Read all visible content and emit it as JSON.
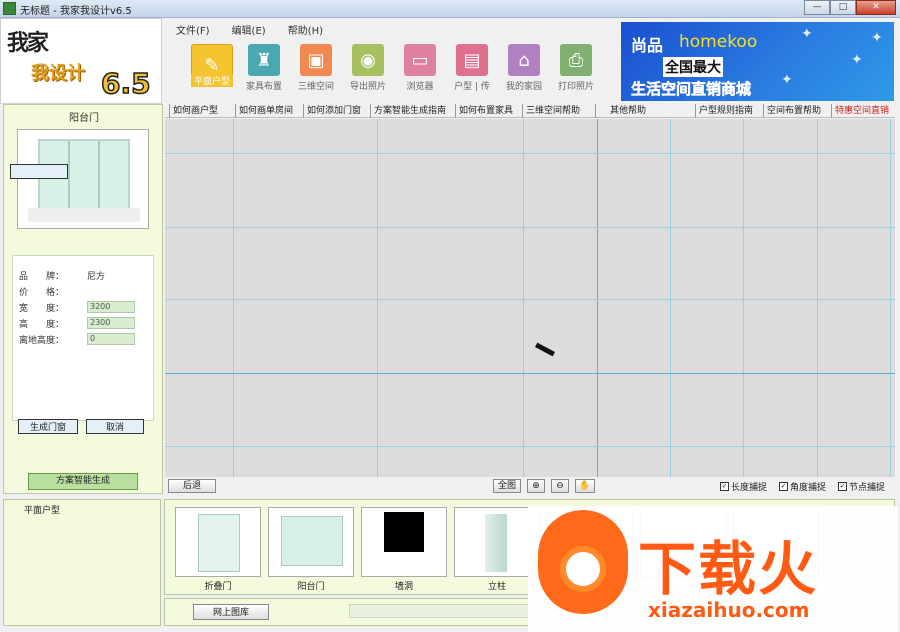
{
  "window": {
    "title": "无标题 - 我家我设计v6.5",
    "min": "—",
    "max": "□",
    "close": "✕"
  },
  "logo": {
    "line1": "我家",
    "line2": "我设计",
    "version": "6.5"
  },
  "menu": [
    "文件(F)",
    "编辑(E)",
    "帮助(H)"
  ],
  "toolbar": [
    {
      "label": "平面户型",
      "icon": "pencil-icon",
      "color": "#f4c430"
    },
    {
      "label": "家具布置",
      "icon": "chair-icon",
      "color": "#4aa8b0"
    },
    {
      "label": "三维空间",
      "icon": "cube-icon",
      "color": "#f08a50"
    },
    {
      "label": "导出照片",
      "icon": "camera-icon",
      "color": "#a8c060"
    },
    {
      "label": "浏览器",
      "icon": "browser-icon",
      "color": "#e080a0"
    },
    {
      "label": "户型 | 传",
      "icon": "save-icon",
      "color": "#e07090"
    },
    {
      "label": "我的家园",
      "icon": "house-icon",
      "color": "#b080c0"
    },
    {
      "label": "打印照片",
      "icon": "printer-icon",
      "color": "#80b070"
    }
  ],
  "banner": {
    "line1": "尚品",
    "line2": "homekoo",
    "line3": "全国最大",
    "line4": "生活空间直销商城"
  },
  "help_tabs": [
    "如何画户型",
    "如何画单房间",
    "如何添加门窗",
    "方案智能生成指南",
    "如何布置家具",
    "三维空间帮助",
    "其他帮助",
    "户型规则指南",
    "空间布置帮助",
    "特惠空间直销"
  ],
  "left": {
    "title": "阳台门",
    "props": [
      {
        "key": "品　　牌：",
        "value": "尼方"
      },
      {
        "key": "价　　格：",
        "value": ""
      },
      {
        "key": "宽　　度：",
        "value": "3200"
      },
      {
        "key": "高　　度：",
        "value": "2300"
      },
      {
        "key": "离地高度：",
        "value": "0"
      }
    ],
    "generate_btn": "生成门窗",
    "cancel_btn": "取消",
    "smart_btn": "方案智能生成"
  },
  "bottombar": {
    "undo": "后退",
    "full": "全图",
    "zoom_in": "⊕",
    "zoom_out": "⊖",
    "pan": "✋",
    "checks": [
      {
        "label": "长度捕捉",
        "checked": true
      },
      {
        "label": "角度捕捉",
        "checked": true
      },
      {
        "label": "节点捕捉",
        "checked": true
      }
    ]
  },
  "category": {
    "title": "平面户型"
  },
  "gallery": [
    {
      "label": "折叠门",
      "icon": "folding-door-icon"
    },
    {
      "label": "阳台门",
      "icon": "balcony-door-icon"
    },
    {
      "label": "墙洞",
      "icon": "wall-opening-icon"
    },
    {
      "label": "立柱",
      "icon": "pillar-icon"
    },
    {
      "label": "",
      "icon": "placeholder-icon"
    },
    {
      "label": "",
      "icon": "placeholder-icon"
    },
    {
      "label": "",
      "icon": "placeholder-icon"
    }
  ],
  "footer": {
    "online_btn": "网上图库"
  },
  "watermark": {
    "text": "下载火",
    "url": "xiazaihuo.com"
  }
}
